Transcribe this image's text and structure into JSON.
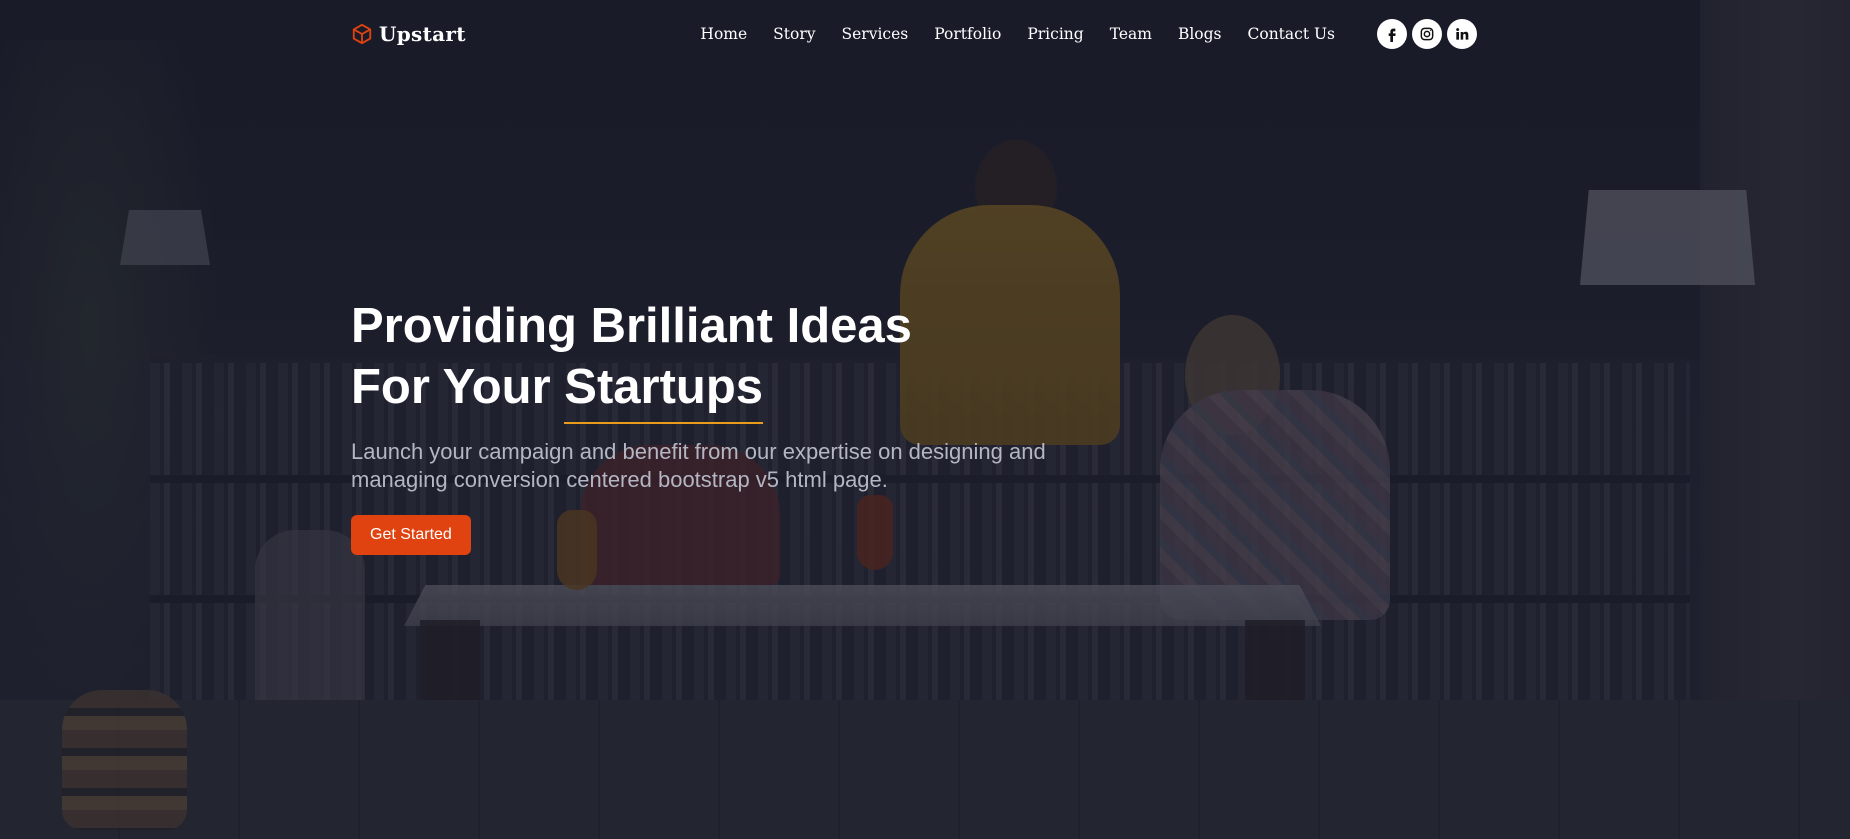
{
  "brand": {
    "name": "Upstart",
    "logo_icon": "cube-icon",
    "accent_color": "#e0430f"
  },
  "nav": {
    "links": [
      {
        "label": "Home"
      },
      {
        "label": "Story"
      },
      {
        "label": "Services"
      },
      {
        "label": "Portfolio"
      },
      {
        "label": "Pricing"
      },
      {
        "label": "Team"
      },
      {
        "label": "Blogs"
      },
      {
        "label": "Contact Us"
      }
    ]
  },
  "socials": [
    {
      "icon": "facebook-icon"
    },
    {
      "icon": "instagram-icon"
    },
    {
      "icon": "linkedin-icon"
    }
  ],
  "hero": {
    "title_line1": "Providing Brilliant Ideas",
    "title_line2_prefix": "For Your ",
    "title_line2_highlight": "Startups",
    "subtitle": "Launch your campaign and benefit from our expertise on designing and managing conversion centered bootstrap v5 html page.",
    "cta_label": "Get Started",
    "underline_color": "#e99b1c"
  }
}
